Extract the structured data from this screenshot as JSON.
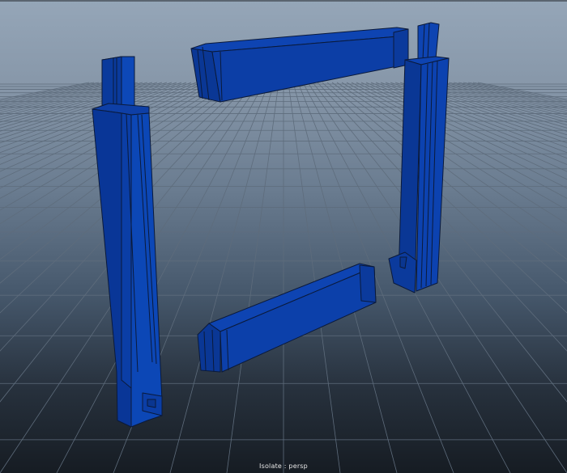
{
  "viewport": {
    "camera_label": "Isolate : persp",
    "grid": true,
    "object_color": "#0a3c9e",
    "object_edge_color": "#0b1a3a",
    "grid_color": "#5e6c7c"
  }
}
